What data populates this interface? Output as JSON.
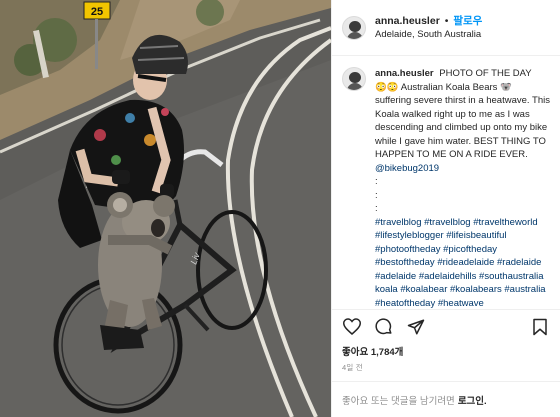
{
  "photo": {
    "road_sign": "25"
  },
  "header": {
    "username": "anna.heusler",
    "separator": "•",
    "follow_label": "팔로우",
    "location": "Adelaide, South Australia"
  },
  "caption": {
    "username": "anna.heusler",
    "lines": [
      "PHOTO OF THE DAY",
      "😳😳 Australian Koala Bears 🐨 suffering severe thirst in a heatwave. This Koala walked right up to me as I was descending and climbed up onto my bike while I gave him water. BEST THING TO HAPPEN TO ME ON A RIDE EVER.",
      "@bikebug2019",
      ":",
      ":",
      ":"
    ],
    "hashtags": "#travelblog #travelblog #traveltheworld #lifestyleblogger #lifeisbeautiful #photooftheday #picoftheday #bestoftheday #rideadelaide #radelaide #adelaide #adelaidehills #southaustralia koala #koalabear #koalabears #australia #heatoftheday #heatwave"
  },
  "actions": {
    "like_icon": "heart-icon",
    "comment_icon": "comment-icon",
    "share_icon": "share-icon",
    "save_icon": "bookmark-icon"
  },
  "likes_label": "좋아요 1,784개",
  "time_label": "4일 전",
  "add_comment": {
    "prompt": "좋아요 또는 댓글을 남기려면",
    "login_label": "로그인."
  }
}
